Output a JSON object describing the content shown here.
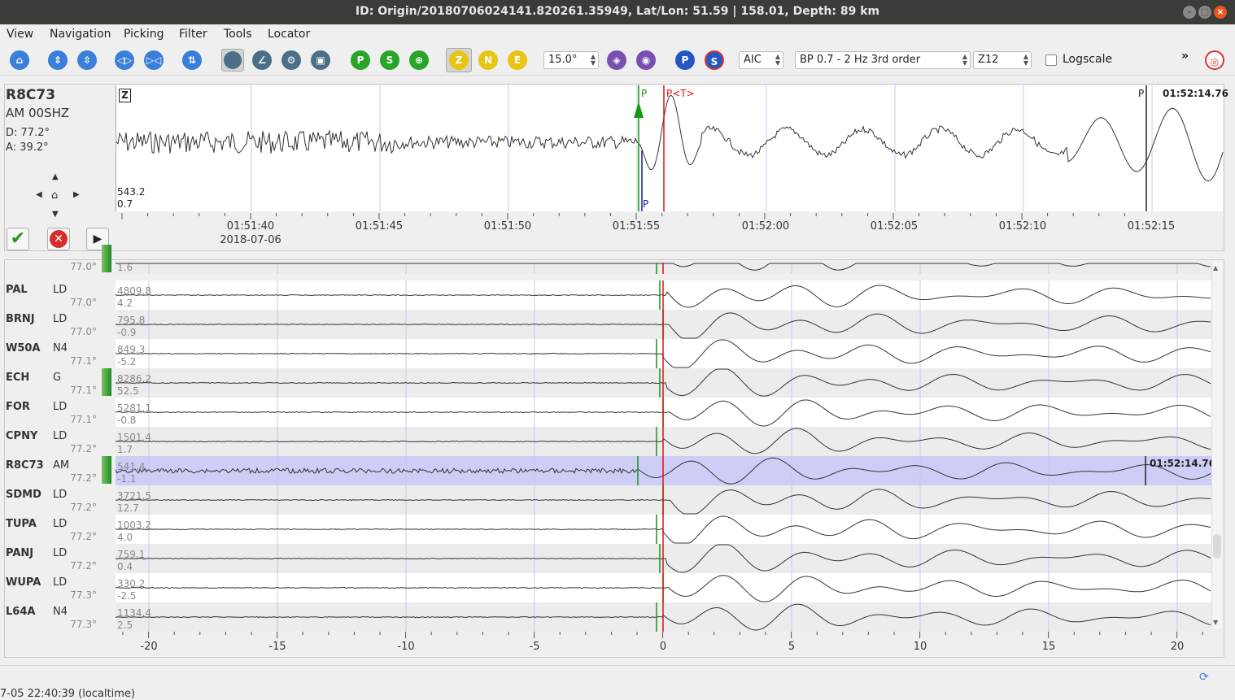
{
  "window": {
    "title": "ID: Origin/20180706024141.820261.35949, Lat/Lon: 51.59 | 158.01, Depth: 89 km"
  },
  "menu": [
    "View",
    "Navigation",
    "Picking",
    "Filter",
    "Tools",
    "Locator"
  ],
  "toolbar": {
    "components": [
      "Z",
      "N",
      "E"
    ],
    "p_label": "P",
    "s_label": "S",
    "angle_value": "15.0°",
    "picker": "AIC",
    "filter": "BP 0.7 - 2 Hz  3rd order",
    "channel": "Z12",
    "logscale_label": "Logscale",
    "overflow": "»"
  },
  "main_trace": {
    "station": "R8C73",
    "stream": "AM  00SHZ",
    "distance": "D:  77.2°",
    "azimuth": "A:  39.2°",
    "component_badge": "Z",
    "amp_max": "543.2",
    "amp_min": "0.7",
    "pick_label_P": "P",
    "pick_label_T": "P<T>",
    "pick_label_end": "P",
    "pick_time": "01:52:14.76",
    "time_ticks": [
      "01:51:40",
      "01:51:45",
      "01:51:50",
      "01:51:55",
      "01:52:00",
      "01:52:05",
      "01:52:10",
      "01:52:15"
    ],
    "date_label": "2018-07-06"
  },
  "rows": [
    {
      "code": "",
      "net": "",
      "dist": "77.0°",
      "amp_max": "",
      "amp_min": "1.6",
      "picked": true
    },
    {
      "code": "PAL",
      "net": "LD",
      "dist": "77.0°",
      "amp_max": "4809.8",
      "amp_min": "4.2",
      "picked": false
    },
    {
      "code": "BRNJ",
      "net": "LD",
      "dist": "77.0°",
      "amp_max": "795.8",
      "amp_min": "-0.9",
      "picked": false
    },
    {
      "code": "W50A",
      "net": "N4",
      "dist": "77.1°",
      "amp_max": "849.3",
      "amp_min": "-5.2",
      "picked": false
    },
    {
      "code": "ECH",
      "net": "G",
      "dist": "77.1°",
      "amp_max": "8286.2",
      "amp_min": "52.5",
      "picked": true
    },
    {
      "code": "FOR",
      "net": "LD",
      "dist": "77.1°",
      "amp_max": "5281.1",
      "amp_min": "-0.8",
      "picked": false
    },
    {
      "code": "CPNY",
      "net": "LD",
      "dist": "77.2°",
      "amp_max": "1501.4",
      "amp_min": "1.7",
      "picked": false
    },
    {
      "code": "R8C73",
      "net": "AM",
      "dist": "77.2°",
      "amp_max": "541.4",
      "amp_min": "-1.1",
      "picked": true,
      "selected": true
    },
    {
      "code": "SDMD",
      "net": "LD",
      "dist": "77.2°",
      "amp_max": "3721.5",
      "amp_min": "12.7",
      "picked": false
    },
    {
      "code": "TUPA",
      "net": "LD",
      "dist": "77.2°",
      "amp_max": "1003.2",
      "amp_min": "4.0",
      "picked": false
    },
    {
      "code": "PANJ",
      "net": "LD",
      "dist": "77.2°",
      "amp_max": "759.1",
      "amp_min": "0.4",
      "picked": false
    },
    {
      "code": "WUPA",
      "net": "LD",
      "dist": "77.3°",
      "amp_max": "330.2",
      "amp_min": "-2.5",
      "picked": false
    },
    {
      "code": "L64A",
      "net": "N4",
      "dist": "77.3°",
      "amp_max": "1134.4",
      "amp_min": "2.5",
      "picked": false
    }
  ],
  "list_axis_ticks": [
    "-20",
    "-15",
    "-10",
    "-5",
    "0",
    "5",
    "10",
    "15",
    "20"
  ],
  "selected_pick_time": "01:52:14.76",
  "status": "7-05 22:40:39 (localtime)",
  "colors": {
    "pick_p": "#119911",
    "pick_t": "#dd1111",
    "pick_blue": "#1a1a99",
    "selected_row": "#cdcdf5"
  }
}
